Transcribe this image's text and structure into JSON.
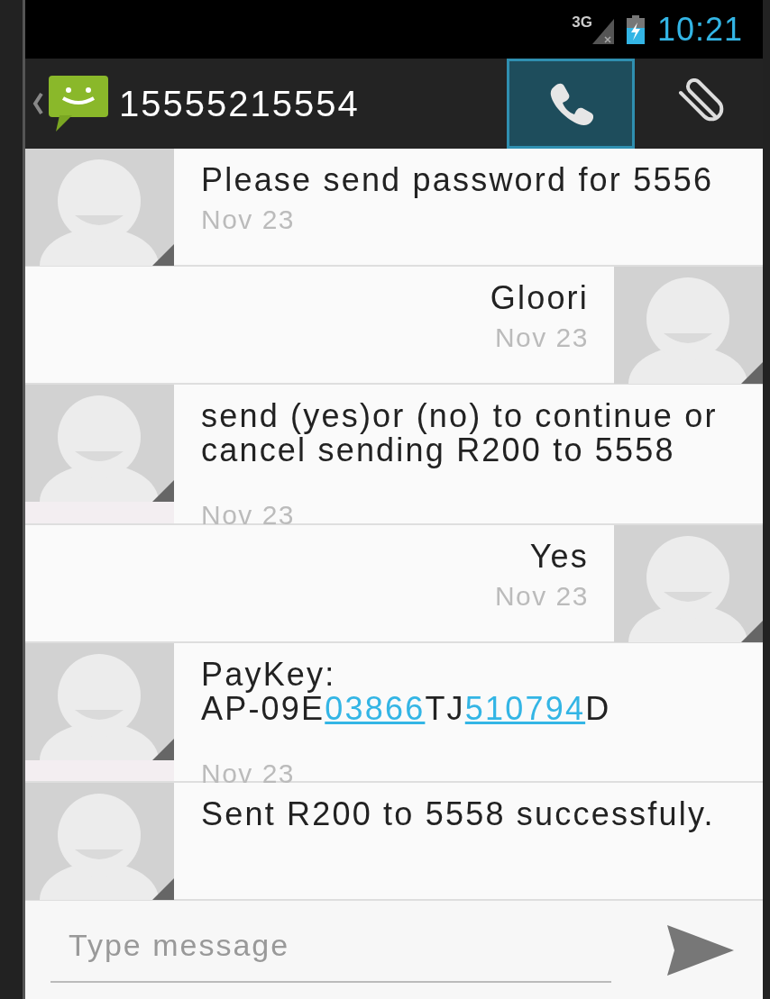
{
  "status_bar": {
    "network": "3G",
    "time": "10:21"
  },
  "action_bar": {
    "contact": "15555215554",
    "actions": [
      {
        "kind": "call",
        "selected": true
      },
      {
        "kind": "attach",
        "selected": false
      }
    ]
  },
  "messages": [
    {
      "kind": "incoming",
      "parts": [
        {
          "text": "Please send password for 5556",
          "link": false
        }
      ],
      "date": "Nov 23"
    },
    {
      "kind": "outgoing",
      "parts": [
        {
          "text": "Gloori",
          "link": false
        }
      ],
      "date": "Nov 23"
    },
    {
      "kind": "incoming",
      "parts": [
        {
          "text": "send (yes)or (no) to continue or cancel sending R200 to 5558",
          "link": false
        }
      ],
      "date": "Nov 23"
    },
    {
      "kind": "outgoing",
      "parts": [
        {
          "text": "Yes",
          "link": false
        }
      ],
      "date": "Nov 23"
    },
    {
      "kind": "incoming",
      "parts": [
        {
          "text": "PayKey:\nAP-09E",
          "link": false
        },
        {
          "text": "03866",
          "link": true
        },
        {
          "text": "TJ",
          "link": false
        },
        {
          "text": "510794",
          "link": true
        },
        {
          "text": "D",
          "link": false
        }
      ],
      "date": "Nov 23"
    },
    {
      "kind": "incoming",
      "parts": [
        {
          "text": "Sent R200 to 5558 successfuly.",
          "link": false
        }
      ]
    }
  ],
  "composer": {
    "placeholder": "Type message"
  }
}
